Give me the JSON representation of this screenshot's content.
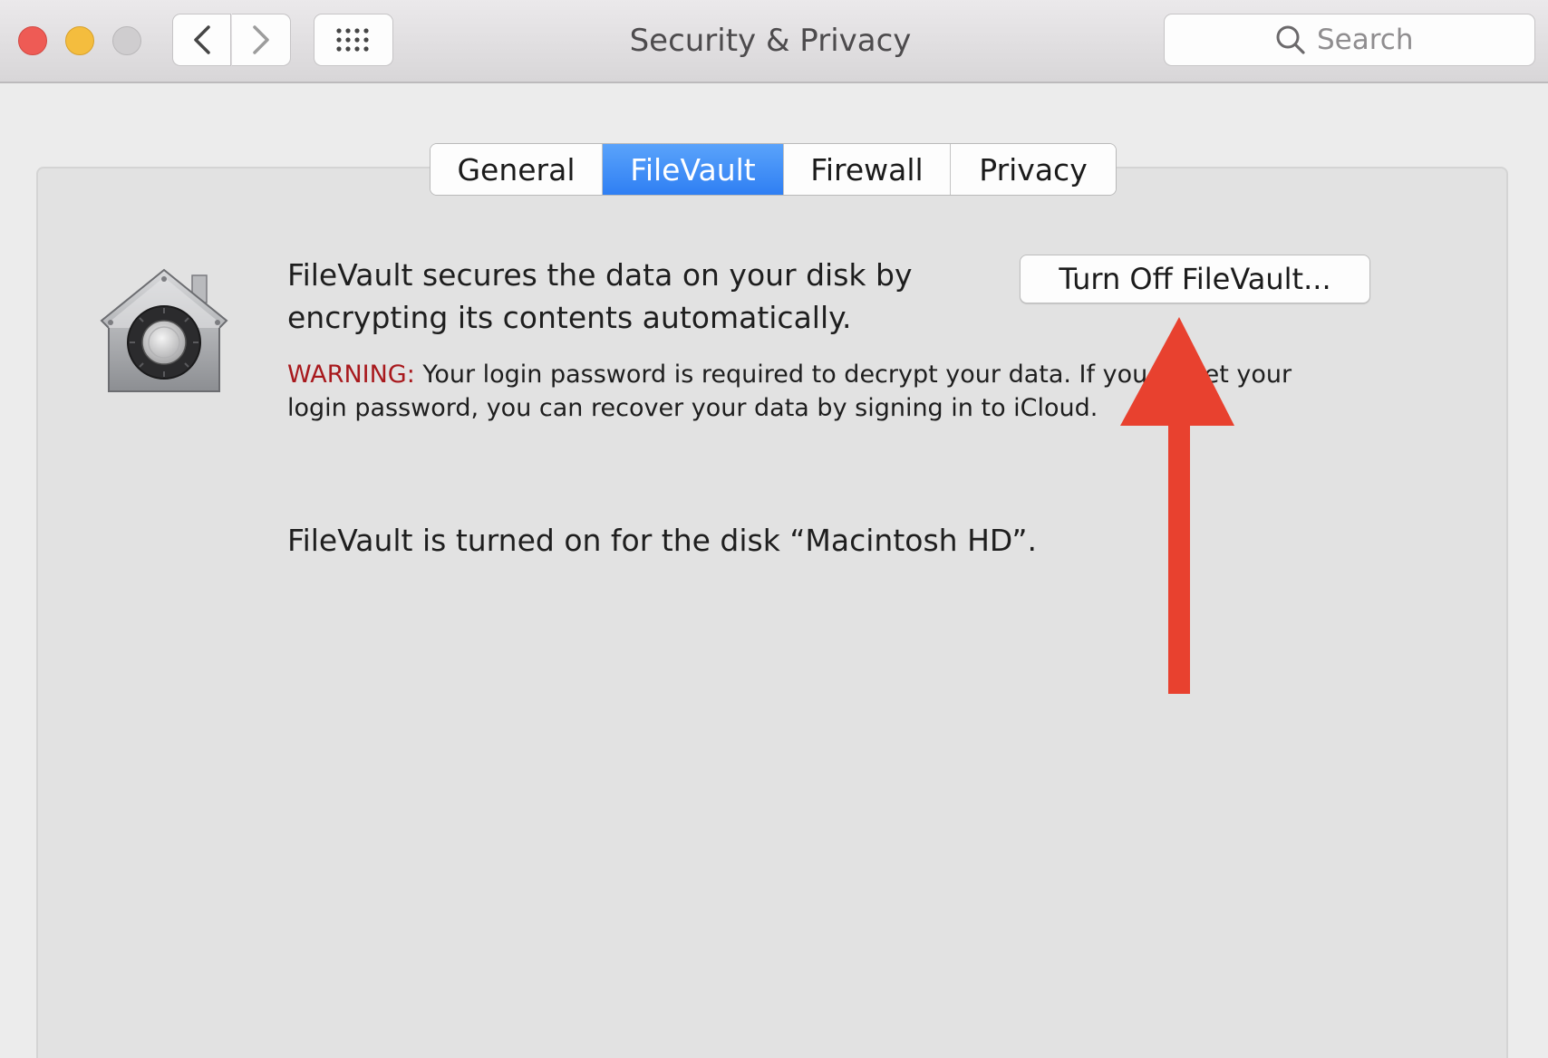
{
  "window": {
    "title": "Security & Privacy"
  },
  "toolbar": {
    "search_placeholder": "Search",
    "icons": [
      "back-chevron-icon",
      "forward-chevron-icon",
      "grid-icon",
      "search-icon"
    ]
  },
  "tabs": [
    {
      "label": "General",
      "selected": false
    },
    {
      "label": "FileVault",
      "selected": true
    },
    {
      "label": "Firewall",
      "selected": false
    },
    {
      "label": "Privacy",
      "selected": false
    }
  ],
  "filevault": {
    "description_line1": "FileVault secures the data on your disk by",
    "description_line2": "encrypting its contents automatically.",
    "warning_label": "WARNING:",
    "warning_line1": " Your login password is required to decrypt your data. If you forget your",
    "warning_line2": "login password, you can recover your data by signing in to iCloud.",
    "turn_off_label": "Turn Off FileVault...",
    "status": "FileVault is turned on for the disk “Macintosh HD”."
  },
  "colors": {
    "accent_tab": "#3a8af6",
    "warning_text": "#a8191d",
    "annotation_arrow": "#e8412f",
    "close_button": "#ee5b55",
    "minimize_button": "#f4bd3e"
  }
}
